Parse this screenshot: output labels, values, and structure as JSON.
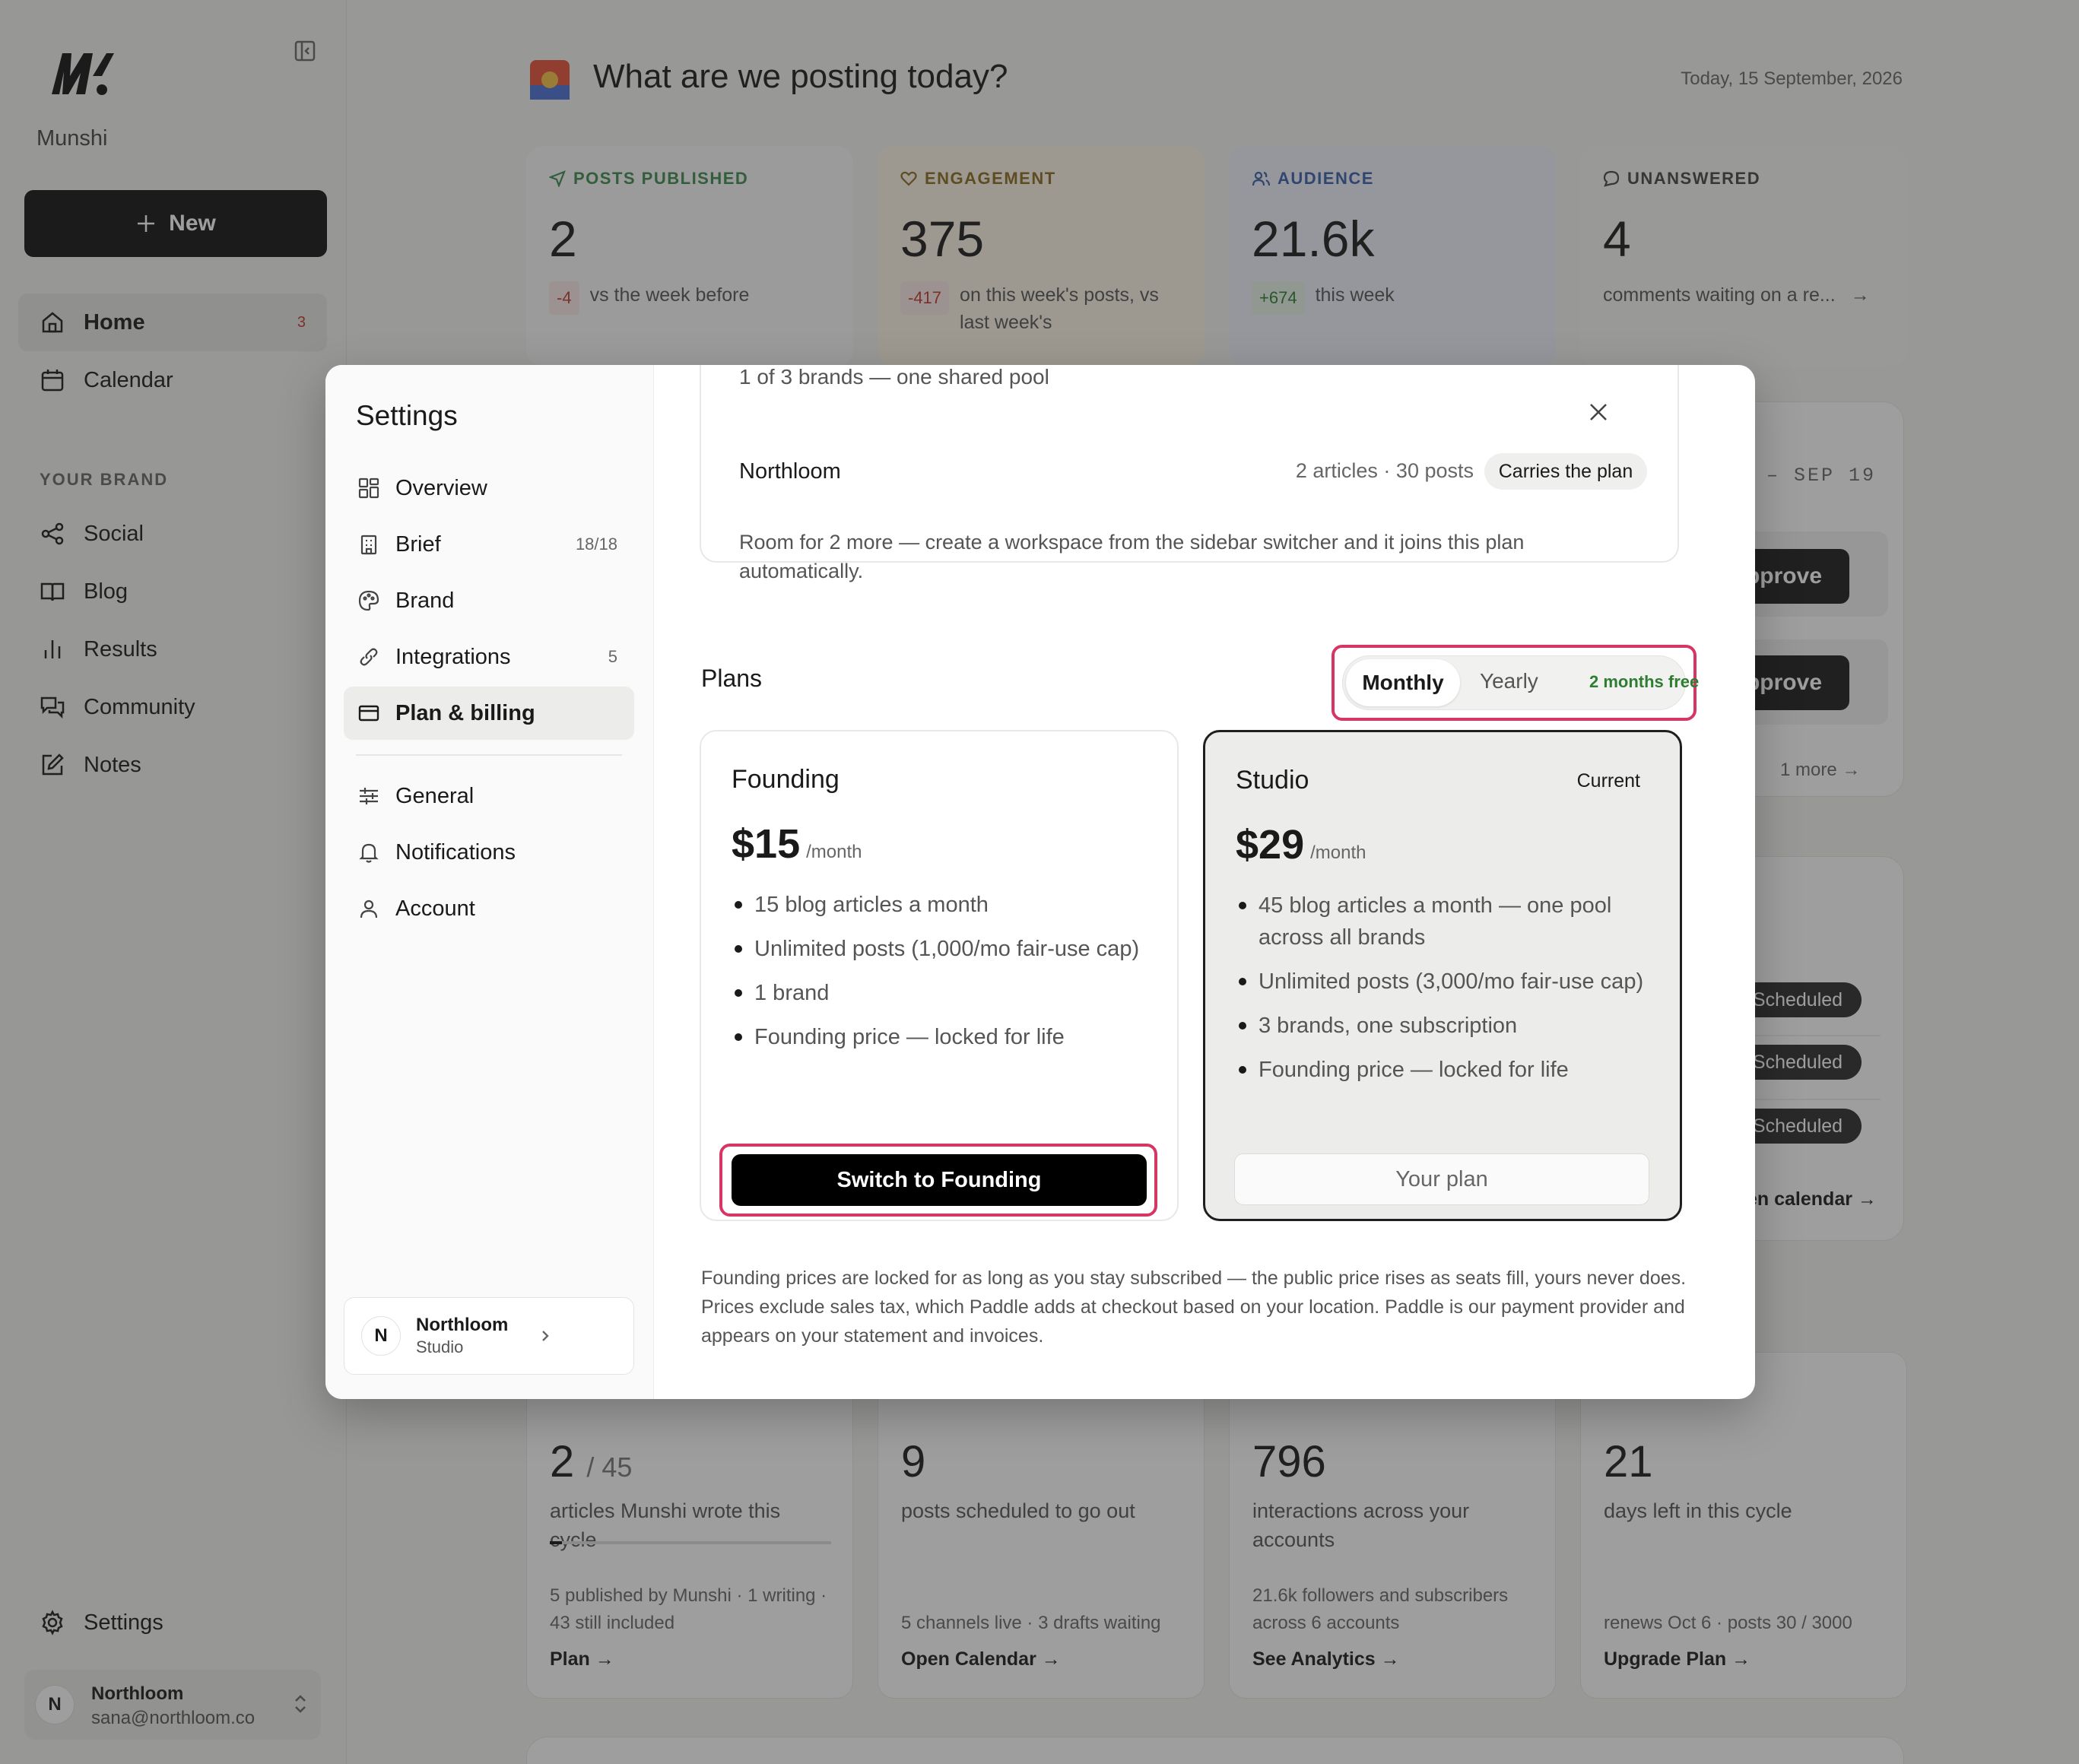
{
  "sidebar": {
    "brand_name": "Munshi",
    "new_label": "New",
    "nav": [
      {
        "label": "Home",
        "badge": "3"
      },
      {
        "label": "Calendar"
      }
    ],
    "section_label": "YOUR BRAND",
    "brand_nav": [
      {
        "label": "Social"
      },
      {
        "label": "Blog"
      },
      {
        "label": "Results"
      },
      {
        "label": "Community"
      },
      {
        "label": "Notes"
      }
    ],
    "settings_label": "Settings",
    "user": {
      "initial": "N",
      "name": "Northloom",
      "email": "sana@northloom.co"
    }
  },
  "dashboard": {
    "title": "What are we posting today?",
    "date": "Today, 15 September, 2026",
    "stats": [
      {
        "label": "POSTS PUBLISHED",
        "value": "2",
        "delta": "-4",
        "note": "vs the week before",
        "color": "#3d8a4f"
      },
      {
        "label": "ENGAGEMENT",
        "value": "375",
        "delta": "-417",
        "note": "on this week's posts, vs last week's",
        "color": "#8a6a1f"
      },
      {
        "label": "AUDIENCE",
        "value": "21.6k",
        "delta": "+674",
        "note": "this week",
        "color": "#3a5fa8"
      },
      {
        "label": "UNANSWERED",
        "value": "4",
        "delta": "",
        "note": "comments waiting on a re...",
        "color": "#444444"
      }
    ],
    "week_range": "– SEP 19",
    "approve_label": "pprove",
    "more_label": "1 more",
    "scheduled_label": "Scheduled",
    "calendar_link": "en calendar →",
    "cycle_cards": [
      {
        "value": "2",
        "total": "/ 45",
        "desc": "articles Munshi wrote this cycle",
        "foot": "5 published by Munshi · 1 writing · 43 still included",
        "link": "Plan →",
        "progress": 0.044
      },
      {
        "value": "9",
        "total": "",
        "desc": "posts scheduled to go out",
        "foot": "5 channels live · 3 drafts waiting",
        "link": "Open Calendar →"
      },
      {
        "value": "796",
        "total": "",
        "desc": "interactions across your accounts",
        "foot": "21.6k followers and subscribers across 6 accounts",
        "link": "See Analytics →"
      },
      {
        "value": "21",
        "total": "",
        "desc": "days left in this cycle",
        "foot": "renews Oct 6 · posts 30 / 3000",
        "link": "Upgrade Plan →"
      }
    ]
  },
  "settings": {
    "title": "Settings",
    "nav": [
      {
        "label": "Overview",
        "count": ""
      },
      {
        "label": "Brief",
        "count": "18/18"
      },
      {
        "label": "Brand",
        "count": ""
      },
      {
        "label": "Integrations",
        "count": "5"
      },
      {
        "label": "Plan & billing",
        "count": ""
      }
    ],
    "nav2": [
      {
        "label": "General"
      },
      {
        "label": "Notifications"
      },
      {
        "label": "Account"
      }
    ],
    "workspace": {
      "initial": "N",
      "name": "Northloom",
      "plan": "Studio"
    },
    "pool_text": "1 of 3 brands — one shared pool",
    "brand_row": {
      "name": "Northloom",
      "meta": "2 articles · 30 posts",
      "pill": "Carries the plan"
    },
    "room_text": "Room for 2 more — create a workspace from the sidebar switcher and it joins this plan automatically.",
    "plans_title": "Plans",
    "toggle": {
      "monthly": "Monthly",
      "yearly": "Yearly",
      "free": "2 months free"
    },
    "plans": [
      {
        "name": "Founding",
        "price": "$15",
        "period": "/month",
        "features": [
          "15 blog articles a month",
          "Unlimited posts (1,000/mo fair-use cap)",
          "1 brand",
          "Founding price — locked for life"
        ],
        "cta": "Switch to Founding"
      },
      {
        "name": "Studio",
        "badge": "Current",
        "price": "$29",
        "period": "/month",
        "features": [
          "45 blog articles a month — one pool across all brands",
          "Unlimited posts (3,000/mo fair-use cap)",
          "3 brands, one subscription",
          "Founding price — locked for life"
        ],
        "cta": "Your plan"
      }
    ],
    "footnote": "Founding prices are locked for as long as you stay subscribed — the public price rises as seats fill, yours never does. Prices exclude sales tax, which Paddle adds at checkout based on your location. Paddle is our payment provider and appears on your statement and invoices."
  }
}
